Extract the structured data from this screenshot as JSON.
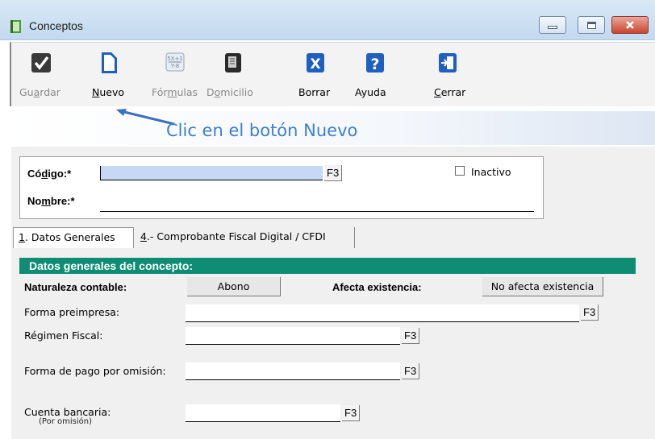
{
  "window": {
    "title": "Conceptos"
  },
  "toolbar": {
    "buttons": [
      {
        "label_pre": "Gu",
        "label_u": "a",
        "label_post": "rdar",
        "icon": "checkmark-icon",
        "enabled": false
      },
      {
        "label_pre": "",
        "label_u": "N",
        "label_post": "uevo",
        "icon": "new-document-icon",
        "enabled": true
      },
      {
        "label_pre": "Fór",
        "label_u": "m",
        "label_post": "ulas",
        "icon": "formula-icon",
        "enabled": false
      },
      {
        "label_pre": "D",
        "label_u": "o",
        "label_post": "micilio",
        "icon": "address-book-icon",
        "enabled": false
      },
      {
        "label_pre": "Borrar",
        "label_u": "",
        "label_post": "",
        "icon": "delete-x-icon",
        "enabled": true
      },
      {
        "label_pre": "Ayuda",
        "label_u": "",
        "label_post": "",
        "icon": "help-icon",
        "enabled": true
      },
      {
        "label_pre": "",
        "label_u": "C",
        "label_post": "errar",
        "icon": "exit-door-icon",
        "enabled": true
      }
    ]
  },
  "annotation": {
    "text": "Clic en el botón Nuevo"
  },
  "header": {
    "codigo_pre": "Có",
    "codigo_u": "d",
    "codigo_post": "igo:*",
    "codigo_value": "",
    "f3": "F3",
    "inactivo_label": "Inactivo",
    "inactivo_checked": false,
    "nombre_pre": "No",
    "nombre_u": "m",
    "nombre_post": "bre:*",
    "nombre_value": ""
  },
  "tabs": [
    {
      "key": "1",
      "label": ". Datos Generales"
    },
    {
      "key": "4",
      "label": ".- Comprobante Fiscal Digital / CFDI"
    }
  ],
  "section": {
    "title": "Datos generales del concepto:",
    "naturaleza_label": "Naturaleza contable:",
    "naturaleza_value": "Abono",
    "afecta_label": "Afecta existencia:",
    "afecta_value": "No afecta existencia",
    "forma_preimpresa_label": "Forma preimpresa:",
    "regimen_label": "Régimen Fiscal:",
    "forma_pago_label": "Forma de pago por omisión:",
    "cuenta_label": "Cuenta bancaria:",
    "cuenta_sub": "(Por omisión)",
    "f3": "F3"
  },
  "colors": {
    "section_bar": "#0e8c74",
    "callout_text": "#3d7fd0",
    "codigo_field": "#c6d8f5"
  }
}
